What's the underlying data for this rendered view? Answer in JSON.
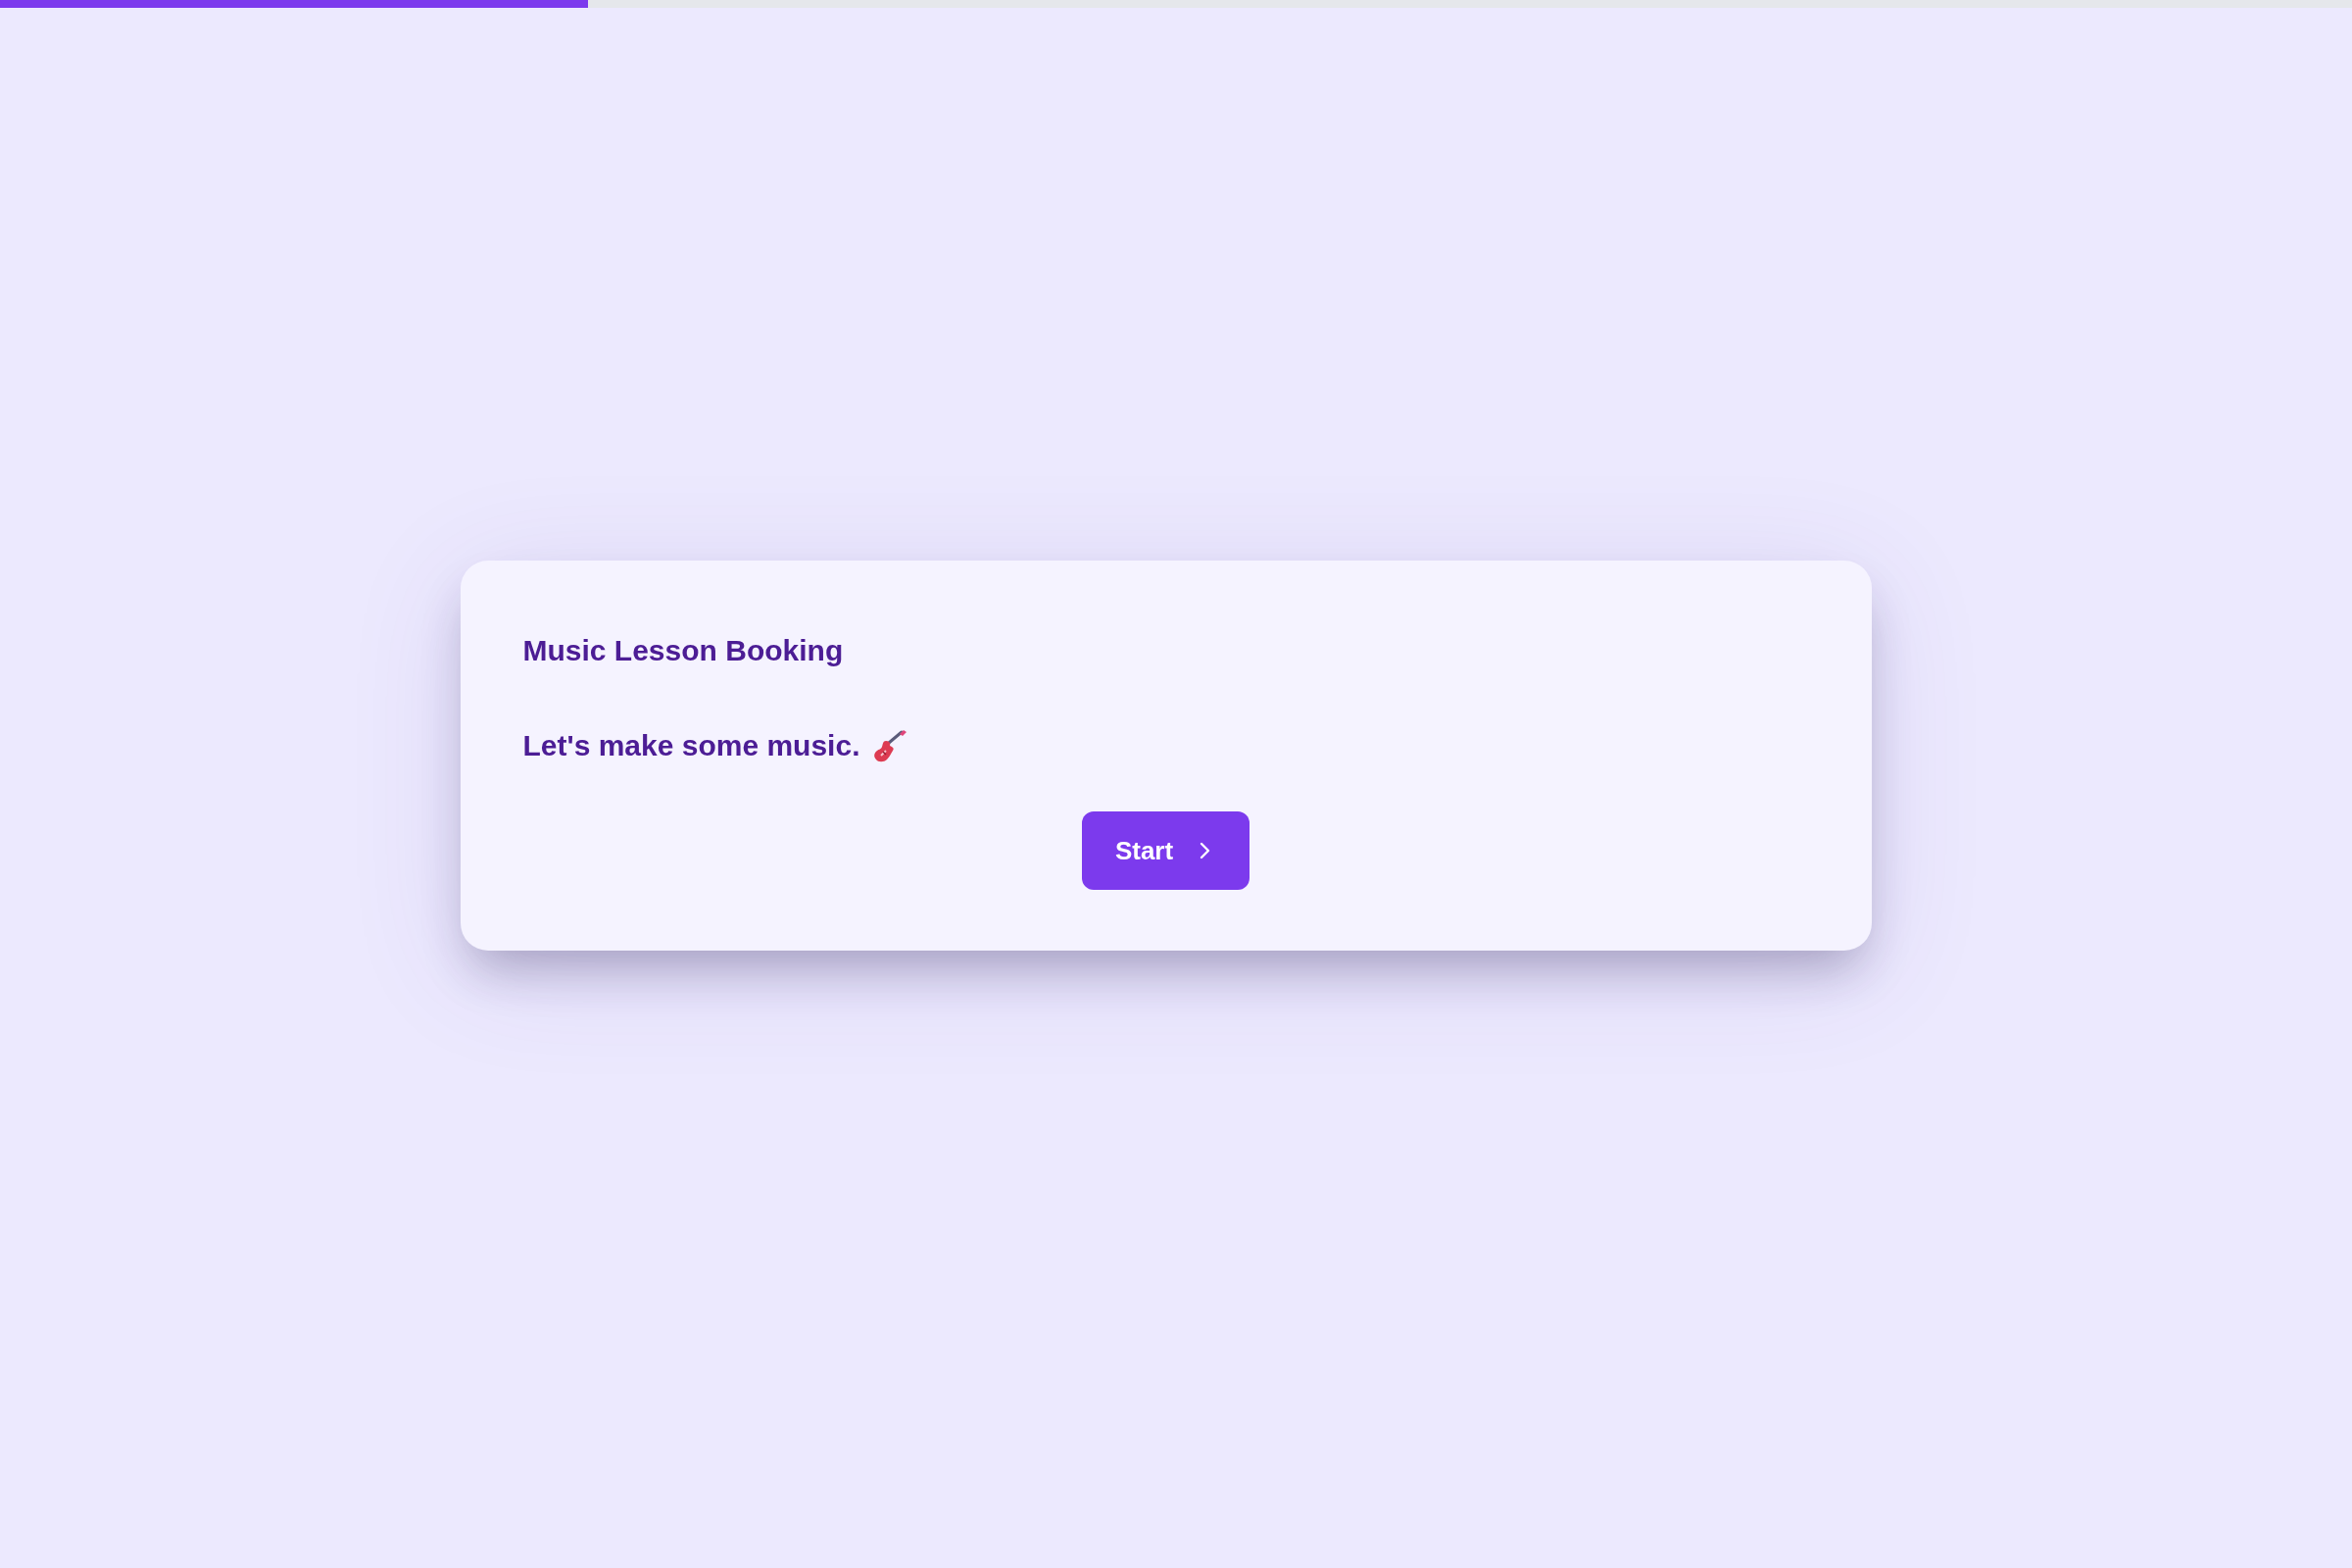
{
  "progress": {
    "level": 0.25
  },
  "card": {
    "title": "Music Lesson Booking",
    "subtitle": "Let's make some music.",
    "button": {
      "label": "Start"
    }
  }
}
